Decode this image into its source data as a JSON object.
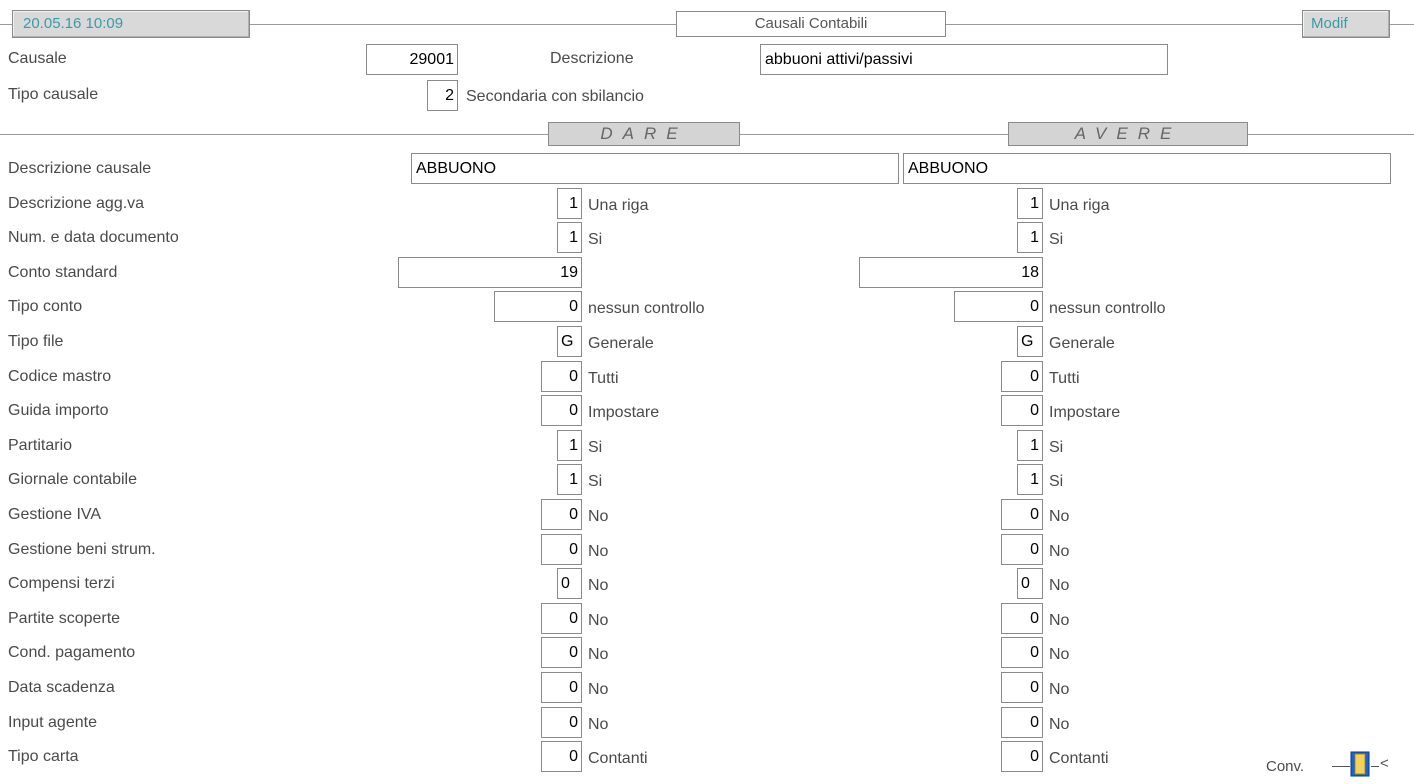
{
  "header": {
    "datetime": "20.05.16 10:09",
    "title": "Causali Contabili",
    "mode": "Modif"
  },
  "top": {
    "causale_label": "Causale",
    "causale_value": "29001",
    "descrizione_label": "Descrizione",
    "descrizione_value": "abbuoni attivi/passivi",
    "tipo_causale_label": "Tipo causale",
    "tipo_causale_value": "2",
    "tipo_causale_desc": "Secondaria con sbilancio"
  },
  "sections": {
    "dare": "DARE",
    "avere": "AVERE"
  },
  "rows": [
    {
      "label": "Descrizione causale",
      "dare": {
        "value": "ABBUONO",
        "desc": ""
      },
      "avere": {
        "value": "ABBUONO",
        "desc": ""
      }
    },
    {
      "label": "Descrizione agg.va",
      "dare": {
        "value": "1",
        "desc": "Una riga"
      },
      "avere": {
        "value": "1",
        "desc": "Una riga"
      }
    },
    {
      "label": "Num. e data documento",
      "dare": {
        "value": "1",
        "desc": "Si"
      },
      "avere": {
        "value": "1",
        "desc": "Si"
      }
    },
    {
      "label": "Conto standard",
      "dare": {
        "value": "19",
        "desc": ""
      },
      "avere": {
        "value": "18",
        "desc": ""
      }
    },
    {
      "label": "Tipo conto",
      "dare": {
        "value": "0",
        "desc": "nessun controllo"
      },
      "avere": {
        "value": "0",
        "desc": "nessun controllo"
      }
    },
    {
      "label": "Tipo file",
      "dare": {
        "value": "G",
        "desc": "Generale"
      },
      "avere": {
        "value": "G",
        "desc": "Generale"
      }
    },
    {
      "label": "Codice mastro",
      "dare": {
        "value": "0",
        "desc": "Tutti"
      },
      "avere": {
        "value": "0",
        "desc": "Tutti"
      }
    },
    {
      "label": "Guida importo",
      "dare": {
        "value": "0",
        "desc": "Impostare"
      },
      "avere": {
        "value": "0",
        "desc": "Impostare"
      }
    },
    {
      "label": "Partitario",
      "dare": {
        "value": "1",
        "desc": "Si"
      },
      "avere": {
        "value": "1",
        "desc": "Si"
      }
    },
    {
      "label": "Giornale contabile",
      "dare": {
        "value": "1",
        "desc": "Si"
      },
      "avere": {
        "value": "1",
        "desc": "Si"
      }
    },
    {
      "label": "Gestione IVA",
      "dare": {
        "value": "0",
        "desc": "No"
      },
      "avere": {
        "value": "0",
        "desc": "No"
      }
    },
    {
      "label": "Gestione beni strum.",
      "dare": {
        "value": "0",
        "desc": "No"
      },
      "avere": {
        "value": "0",
        "desc": "No"
      }
    },
    {
      "label": "Compensi terzi",
      "dare": {
        "value": "0",
        "desc": "No"
      },
      "avere": {
        "value": "0",
        "desc": "No"
      }
    },
    {
      "label": "Partite scoperte",
      "dare": {
        "value": "0",
        "desc": "No"
      },
      "avere": {
        "value": "0",
        "desc": "No"
      }
    },
    {
      "label": "Cond. pagamento",
      "dare": {
        "value": "0",
        "desc": "No"
      },
      "avere": {
        "value": "0",
        "desc": "No"
      }
    },
    {
      "label": "Data scadenza",
      "dare": {
        "value": "0",
        "desc": "No"
      },
      "avere": {
        "value": "0",
        "desc": "No"
      }
    },
    {
      "label": "Input agente",
      "dare": {
        "value": "0",
        "desc": "No"
      },
      "avere": {
        "value": "0",
        "desc": "No"
      }
    },
    {
      "label": "Tipo carta",
      "dare": {
        "value": "0",
        "desc": "Contanti"
      },
      "avere": {
        "value": "0",
        "desc": "Contanti"
      }
    }
  ],
  "footer": {
    "conv_label": "Conv.",
    "conv_icon": "door-icon",
    "conv_suffix": "<"
  },
  "colors": {
    "header_text": "#3a9aa8",
    "label_text": "#4a4a4a",
    "panel_gray": "#d9d9d9"
  }
}
